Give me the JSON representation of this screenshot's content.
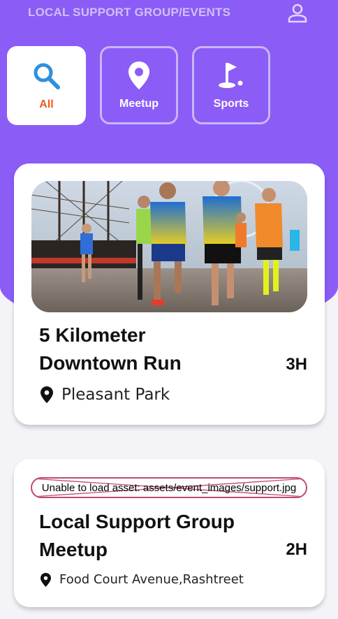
{
  "header": {
    "title": "LOCAL SUPPORT GROUP/EVENTS",
    "profile_icon": "person-outline-icon"
  },
  "filters": [
    {
      "label": "All",
      "icon": "search-icon",
      "selected": true
    },
    {
      "label": "Meetup",
      "icon": "location-pin-icon",
      "selected": false
    },
    {
      "label": "Sports",
      "icon": "golf-flag-icon",
      "selected": false
    }
  ],
  "events": [
    {
      "title": "5 Kilometer Downtown Run",
      "time": "3H",
      "location": "Pleasant Park",
      "image": "marathon-runners-photo"
    },
    {
      "title": "Local Support Group Meetup",
      "time": "2H",
      "location": "Food Court Avenue,Rashtreet",
      "image_error": "Unable to load asset: assets/event_images/support.jpg"
    }
  ],
  "colors": {
    "primary": "#8b5cf6",
    "accent": "#f25a1d",
    "icon_blue": "#2f8fdc",
    "error_border": "#c24a6c"
  }
}
